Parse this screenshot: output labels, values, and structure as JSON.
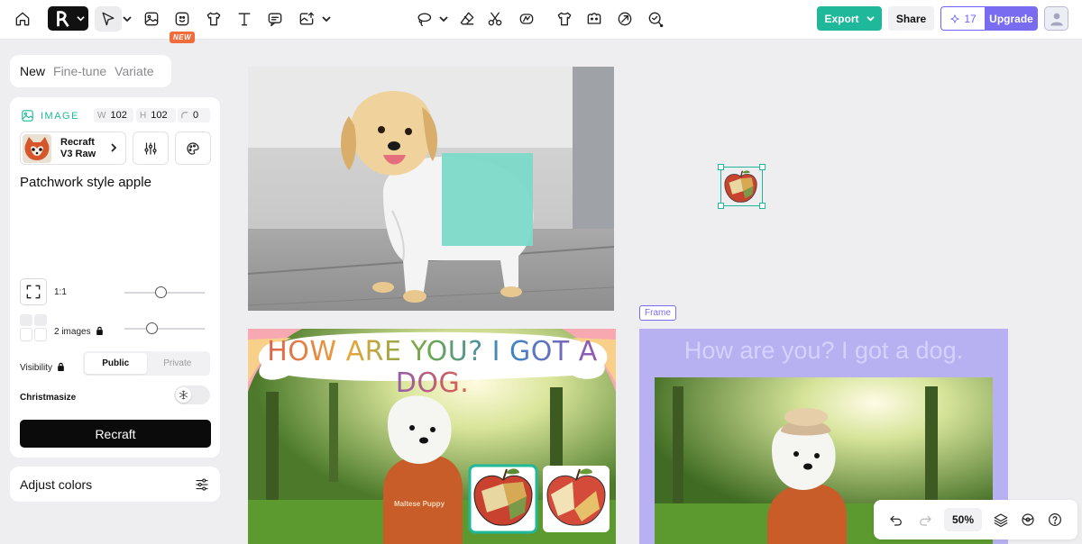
{
  "toolbar": {
    "new_badge": "NEW",
    "export_label": "Export",
    "share_label": "Share",
    "credits": "17",
    "upgrade_label": "Upgrade"
  },
  "mode_tabs": [
    {
      "label": "New",
      "active": true
    },
    {
      "label": "Fine-tune",
      "active": false
    },
    {
      "label": "Variate",
      "active": false
    }
  ],
  "panel": {
    "section_label": "IMAGE",
    "width_label": "W",
    "width_value": "102",
    "height_label": "H",
    "height_value": "102",
    "radius_value": "0",
    "model_name_line1": "Recraft",
    "model_name_line2": "V3 Raw",
    "prompt": "Patchwork style apple",
    "aspect_ratio": "1:1",
    "images_count_label": "2 images",
    "visibility_label": "Visibility",
    "visibility_options": [
      "Public",
      "Private"
    ],
    "visibility_selected": "Public",
    "christmasize_label": "Christmasize",
    "christmasize_on": false,
    "recraft_button": "Recraft",
    "adjust_colors_label": "Adjust colors"
  },
  "canvas": {
    "card_title": "HOW ARE YOU? I GOT A DOG.",
    "card_dog_shirt_text": "Maltese Puppy",
    "frame_label": "Frame",
    "frame_title": "How are you? I got a dog."
  },
  "zoom": {
    "value": "50%"
  },
  "colors": {
    "accent": "#1fb89a",
    "brand_purple": "#7a6cf0",
    "frame_bg": "#b7b1f1",
    "badge_orange": "#f26b3a"
  },
  "icons": {
    "toolbar": [
      "home-icon",
      "logo-icon",
      "select-arrow-icon",
      "image-icon",
      "sticker-icon",
      "tshirt-icon",
      "text-icon",
      "comment-icon",
      "upload-image-icon",
      "lasso-icon",
      "eraser-icon",
      "scissors-icon",
      "vectorize-icon",
      "mockup-icon",
      "remove-bg-icon",
      "creative-upscale-icon",
      "inpaint-icon"
    ]
  }
}
